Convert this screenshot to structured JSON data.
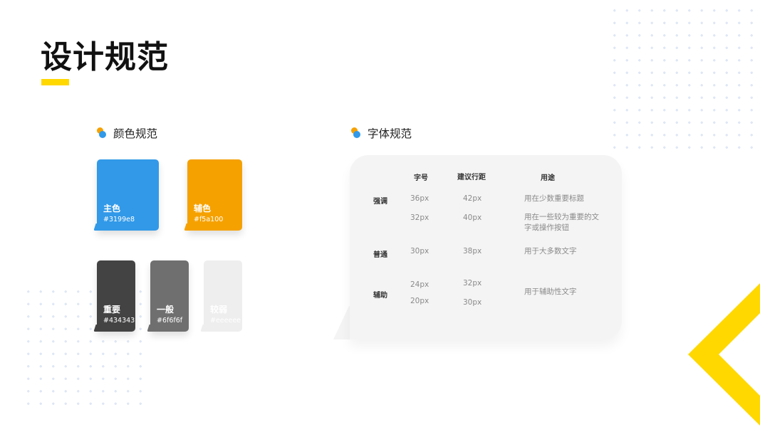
{
  "title": "设计规范",
  "colors": {
    "heading": "颜色规范",
    "primary": {
      "name": "主色",
      "hex": "#3199e8"
    },
    "secondary": {
      "name": "辅色",
      "hex": "#f5a100"
    },
    "dark": {
      "name": "重要",
      "hex": "#434343"
    },
    "mid": {
      "name": "一般",
      "hex": "#6f6f6f"
    },
    "light": {
      "name": "较弱",
      "hex": "#eeeeee"
    },
    "accent": "#ffd800"
  },
  "fonts": {
    "heading": "字体规范",
    "columns": {
      "size": "字号",
      "spacing": "建议行距",
      "usage": "用途"
    },
    "groups": [
      {
        "label": "强调",
        "rows": [
          {
            "size": "36px",
            "spacing": "42px",
            "usage": "用在少数重要标题"
          },
          {
            "size": "32px",
            "spacing": "40px",
            "usage": "用在一些较为重要的文字或操作按钮"
          }
        ]
      },
      {
        "label": "普通",
        "rows": [
          {
            "size": "30px",
            "spacing": "38px",
            "usage": "用于大多数文字"
          }
        ]
      },
      {
        "label": "辅助",
        "rows": [
          {
            "size": "24px",
            "spacing": "32px",
            "usage": "用于辅助性文字"
          },
          {
            "size": "20px",
            "spacing": "30px",
            "usage": ""
          }
        ]
      }
    ]
  }
}
